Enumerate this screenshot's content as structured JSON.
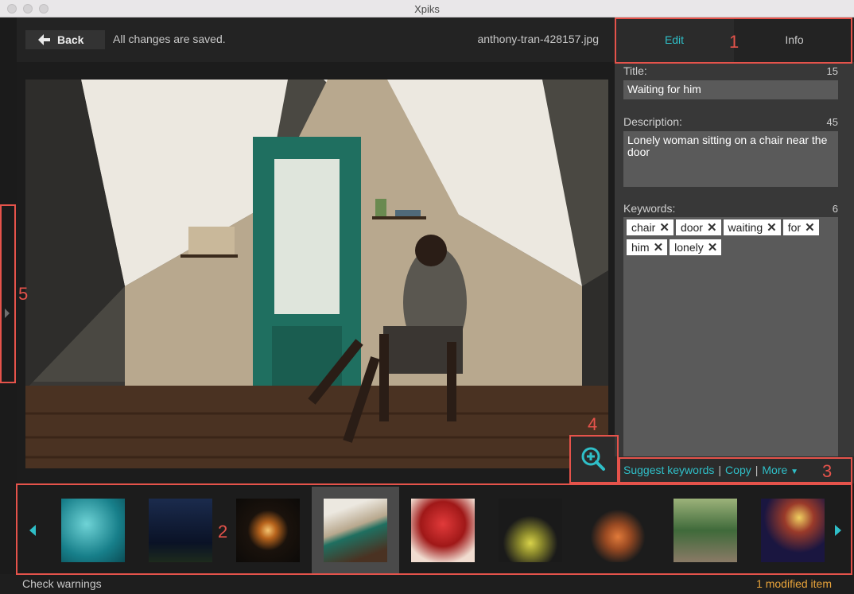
{
  "window": {
    "title": "Xpiks"
  },
  "header": {
    "back_label": "Back",
    "status": "All changes are saved.",
    "filename": "anthony-tran-428157.jpg"
  },
  "tabs": {
    "edit": "Edit",
    "info": "Info"
  },
  "edit": {
    "title_label": "Title:",
    "title_count": "15",
    "title_value": "Waiting for him",
    "description_label": "Description:",
    "description_count": "45",
    "description_value": "Lonely woman sitting on a chair near the door",
    "keywords_label": "Keywords:",
    "keywords_count": "6",
    "keywords": [
      "chair",
      "door",
      "waiting",
      "for",
      "him",
      "lonely"
    ]
  },
  "actions": {
    "suggest": "Suggest keywords",
    "copy": "Copy",
    "more": "More"
  },
  "status_bar": {
    "check_warnings": "Check warnings",
    "modified": "1 modified item"
  },
  "annotations": [
    "1",
    "2",
    "3",
    "4",
    "5"
  ],
  "colors": {
    "accent": "#2fbfc8",
    "annotation": "#e5534b",
    "modified": "#e8a33a"
  },
  "icons": {
    "back": "arrow-left-icon",
    "zoom": "zoom-in-icon",
    "more": "triangle-down-icon",
    "prev": "chevron-left-icon",
    "next": "chevron-right-icon",
    "remove_keyword": "x-icon"
  }
}
